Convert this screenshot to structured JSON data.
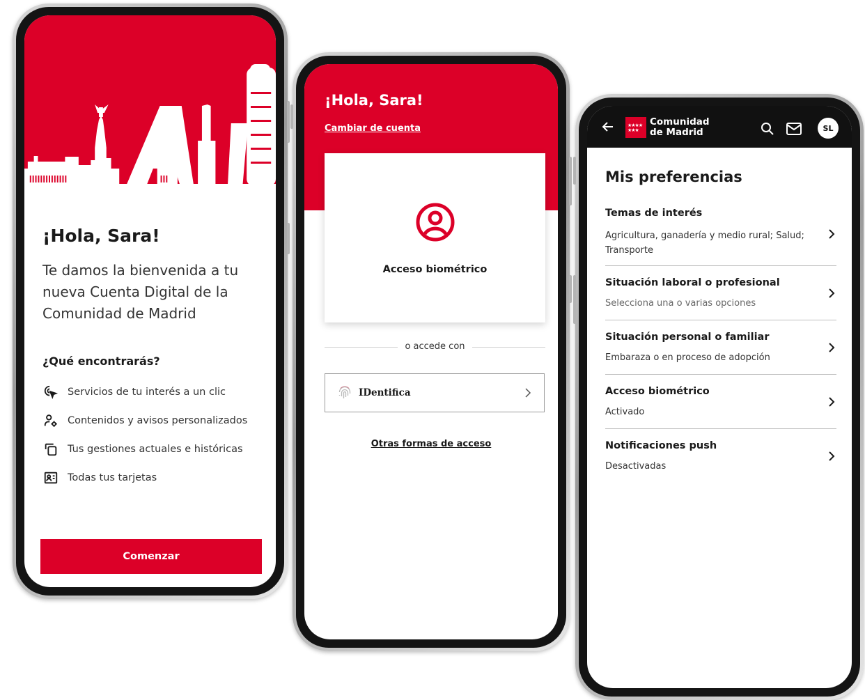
{
  "colors": {
    "brand_red": "#dc0028",
    "header_dark": "#111111"
  },
  "welcome_screen": {
    "title": "¡Hola, Sara!",
    "welcome_text": "Te damos la bienvenida a tu nueva Cuenta Digital de la Comunidad de Madrid",
    "section_title": "¿Qué encontrarás?",
    "features": [
      {
        "icon": "cursor-click-icon",
        "label": "Servicios de tu interés a un clic"
      },
      {
        "icon": "user-settings-icon",
        "label": "Contenidos y avisos personalizados"
      },
      {
        "icon": "documents-icon",
        "label": "Tus gestiones actuales e históricas"
      },
      {
        "icon": "id-card-icon",
        "label": "Todas tus tarjetas"
      }
    ],
    "start_button": "Comenzar"
  },
  "login_screen": {
    "title": "¡Hola, Sara!",
    "switch_account": "Cambiar de cuenta",
    "biometric_label": "Acceso biométrico",
    "divider_text": "o accede con",
    "identifica_label": "IDentifica",
    "other_methods": "Otras formas de acceso"
  },
  "preferences_screen": {
    "brand_line1": "Comunidad",
    "brand_line2": "de Madrid",
    "avatar_initials": "SL",
    "title": "Mis preferencias",
    "items": [
      {
        "title": "Temas de interés",
        "subtitle": "Agricultura, ganadería y medio rural; Salud; Transporte"
      },
      {
        "title": "Situación laboral o profesional",
        "subtitle": "Selecciona una o varias opciones"
      },
      {
        "title": "Situación personal o familiar",
        "subtitle": "Embaraza o en proceso de adopción"
      },
      {
        "title": "Acceso biométrico",
        "subtitle": "Activado"
      },
      {
        "title": "Notificaciones push",
        "subtitle": "Desactivadas"
      }
    ]
  }
}
